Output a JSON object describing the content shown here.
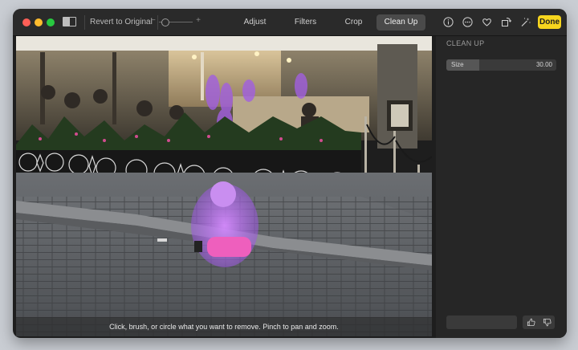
{
  "toolbar": {
    "revert_label": "Revert to Original",
    "zoom_minus": "−",
    "zoom_plus": "+",
    "tabs": [
      "Adjust",
      "Filters",
      "Crop",
      "Clean Up"
    ],
    "active_tab": "Clean Up",
    "zoom_level": 0.1,
    "right_icons": [
      "info-icon",
      "more-icon",
      "heart-icon",
      "rotate-icon",
      "magic-wand-icon"
    ],
    "done_label": "Done"
  },
  "photo": {
    "caption": "Click, brush, or circle what you want to remove. Pinch to pan and zoom."
  },
  "sidebar": {
    "title": "CLEAN UP",
    "size_label": "Size",
    "size_value": "30.00",
    "size_fraction": 0.3,
    "feedback_icons": [
      "thumbs-up-icon",
      "thumbs-down-icon"
    ]
  },
  "colors": {
    "done_button": "#f6d51e",
    "highlight": "#b66bff",
    "window_bg": "#1e1e1e"
  }
}
